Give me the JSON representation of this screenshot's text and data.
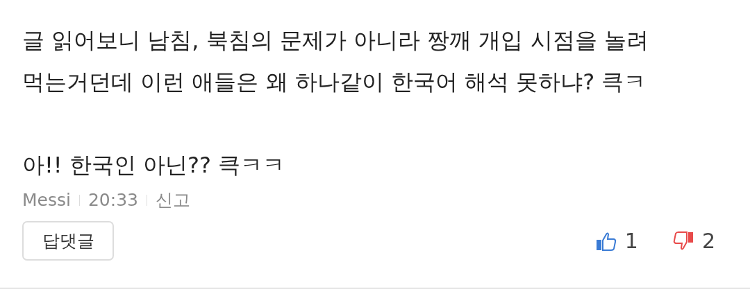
{
  "comment": {
    "paragraphs": [
      [
        "글 읽어보니 남침, 북침의 문제가 아니라 짱깨 개입 시점을 놀려",
        "먹는거던데 이런 애들은 왜 하나같이 한국어 해석 못하냐? 큭ㅋ"
      ],
      [
        "아!! 한국인 아닌?? 큭ㅋㅋ"
      ]
    ],
    "author": "Messi",
    "time": "20:33",
    "report": "신고",
    "reply_button": "답댓글",
    "likes": "1",
    "dislikes": "2"
  }
}
